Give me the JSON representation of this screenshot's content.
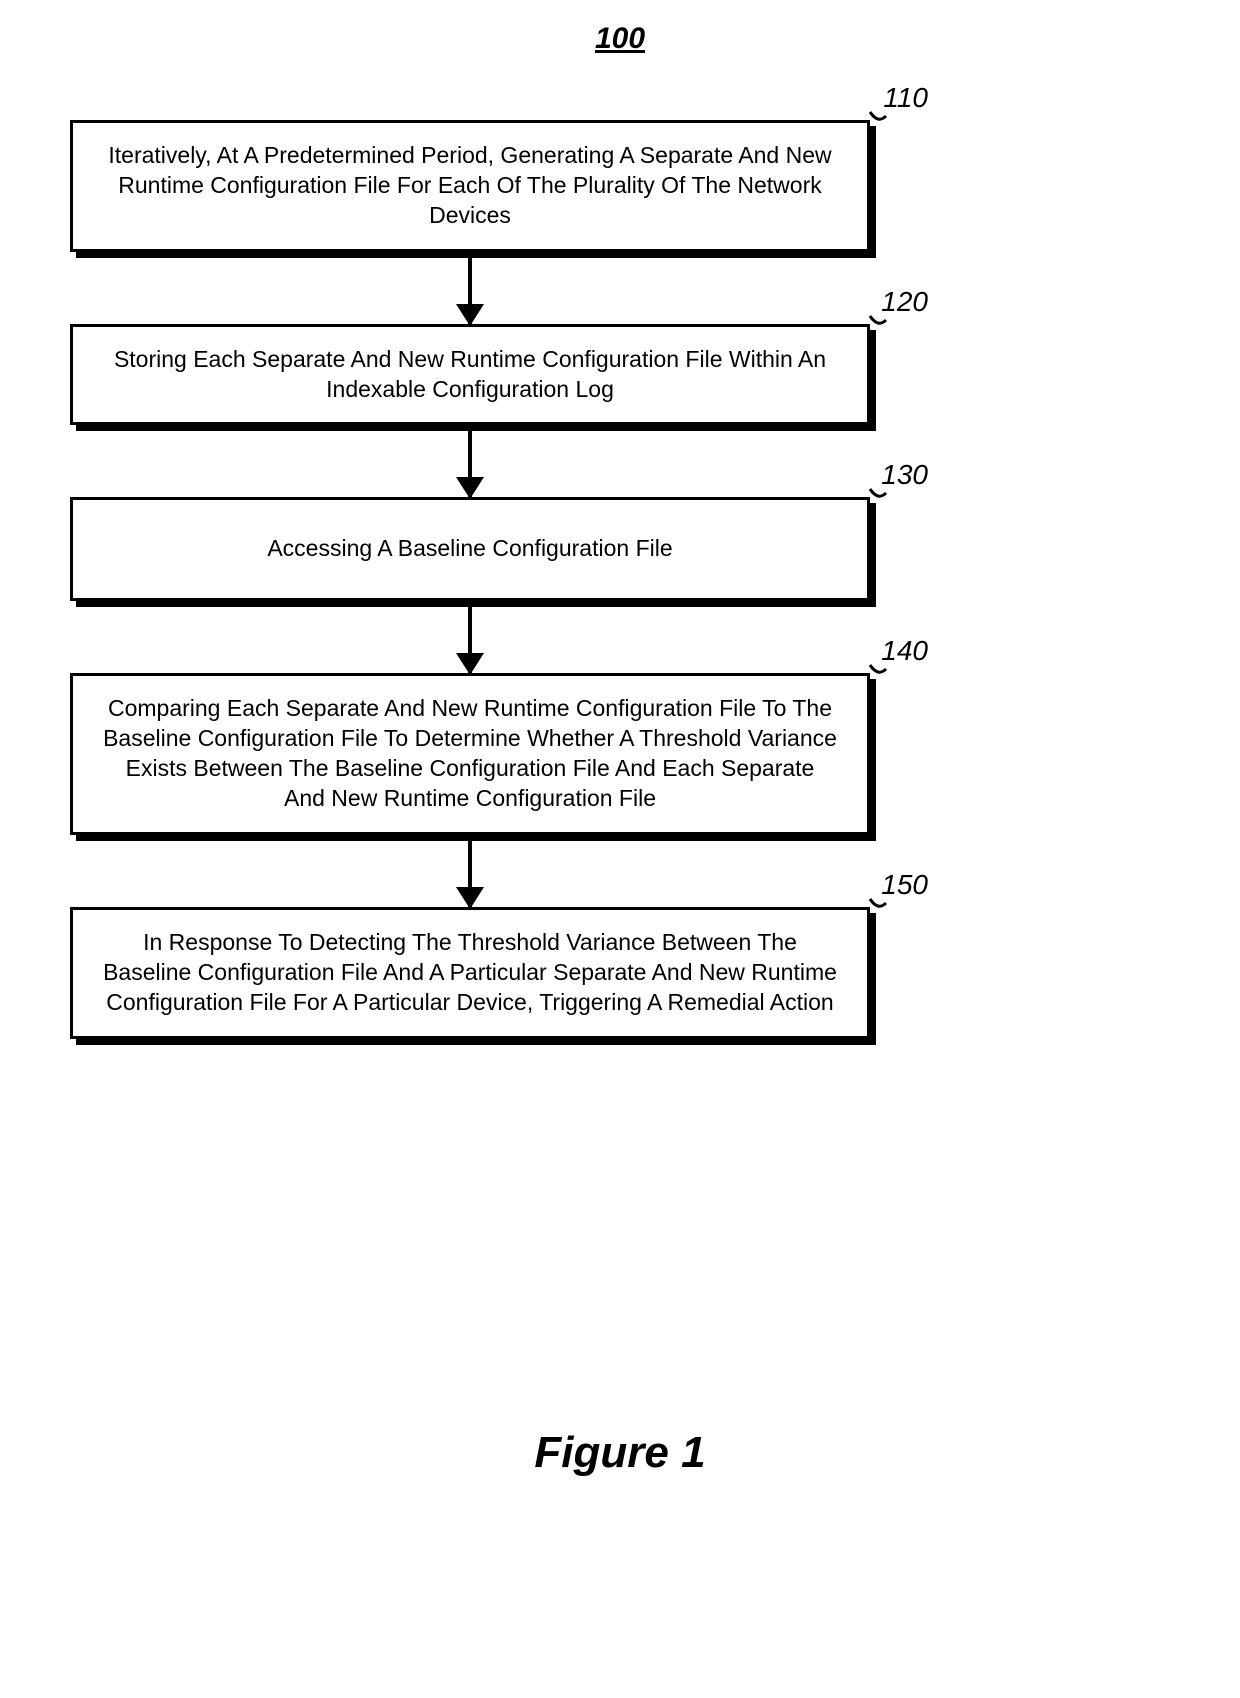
{
  "figure_number": "100",
  "caption": "Figure 1",
  "steps": [
    {
      "ref": "110",
      "text": "Iteratively, At A Predetermined Period, Generating A Separate And New Runtime Configuration File For Each Of The Plurality Of The Network Devices"
    },
    {
      "ref": "120",
      "text": "Storing Each Separate And New Runtime Configuration File Within An Indexable Configuration Log"
    },
    {
      "ref": "130",
      "text": "Accessing A Baseline Configuration File"
    },
    {
      "ref": "140",
      "text": "Comparing Each Separate And New Runtime Configuration File To The Baseline Configuration File To Determine Whether A Threshold Variance Exists Between The Baseline Configuration File And Each Separate And New Runtime Configuration File"
    },
    {
      "ref": "150",
      "text": "In Response To Detecting The Threshold Variance Between The Baseline Configuration File And A Particular Separate And New Runtime Configuration File For A Particular Device, Triggering A Remedial Action"
    }
  ],
  "arrow_heights": [
    72,
    72,
    72,
    72
  ]
}
